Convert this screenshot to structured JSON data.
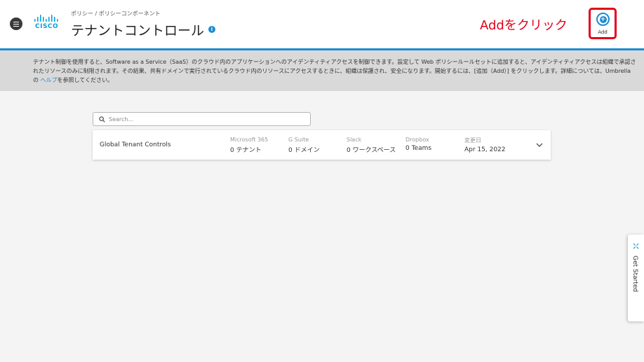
{
  "header": {
    "logo_text": "CISCO",
    "breadcrumb": "ポリシー / ポリシーコンポーネント",
    "title": "テナントコントロール",
    "info_icon_glyph": "i"
  },
  "annotation": {
    "text": "Addをクリック",
    "color": "#e4001a"
  },
  "add_button": {
    "label": "Add",
    "glyph": "+"
  },
  "description": {
    "text_before_link": "テナント制御を使用すると、Software as a Service（SaaS）のクラウド内のアプリケーションへのアイデンティティアクセスを制御できます。設定して Web ポリシールールセットに追加すると、アイデンティティアクセスは組織で承認されたリソースのみに制限されます。その結果、共有ドメインで実行されているクラウド内のリソースにアクセスするときに、組織は保護され、安全になります。開始するには、[追加（Add）] をクリックします。詳細については、Umbrella の ",
    "link_text": "ヘルプ",
    "text_after_link": "を参照してください。"
  },
  "search": {
    "placeholder": "Search..."
  },
  "row": {
    "name": "Global Tenant Controls",
    "stats": [
      {
        "label": "Microsoft 365",
        "value": "0 テナント"
      },
      {
        "label": "G Suite",
        "value": "0 ドメイン"
      },
      {
        "label": "Slack",
        "value": "0 ワークスペース"
      },
      {
        "label": "Dropbox",
        "value": "0 Teams"
      },
      {
        "label": "変更日",
        "value": "Apr 15, 2022"
      }
    ]
  },
  "get_started": {
    "label": "Get Started"
  },
  "colors": {
    "accent": "#1d8bd1",
    "highlight": "#e4001a"
  }
}
